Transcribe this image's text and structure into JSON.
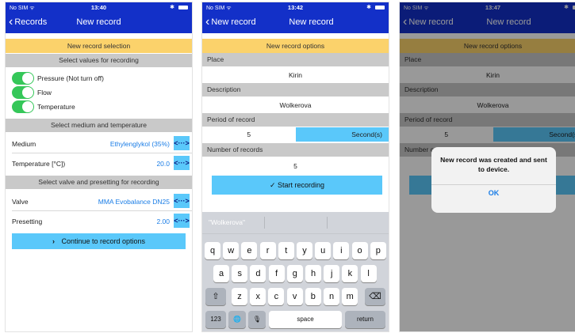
{
  "screen1": {
    "status": {
      "carrier": "No SIM ᯤ",
      "time": "13:40",
      "bt": "✱"
    },
    "nav": {
      "back": "Records",
      "title": "New record"
    },
    "banner": "New record selection",
    "section1": "Select values for recording",
    "toggles": [
      {
        "label": "Pressure (Not turn off)"
      },
      {
        "label": "Flow"
      },
      {
        "label": "Temperature"
      }
    ],
    "section2": "Select medium and temperature",
    "medium": {
      "label": "Medium",
      "value": "Ethylenglykol (35%)"
    },
    "temperature": {
      "label": "Temperature [°C])",
      "value": "20.0"
    },
    "section3": "Select valve and presetting for recording",
    "valve": {
      "label": "Valve",
      "value": "MMA Evobalance DN25"
    },
    "presetting": {
      "label": "Presetting",
      "value": "2.00"
    },
    "continue_button": "Continue to record options",
    "arrow_glyph": "<···>"
  },
  "screen2": {
    "status": {
      "carrier": "No SIM ᯤ",
      "time": "13:42",
      "bt": "✱"
    },
    "nav": {
      "back": "New record",
      "title": "New record"
    },
    "banner": "New record options",
    "place": {
      "label": "Place",
      "value": "Kirin"
    },
    "description": {
      "label": "Description",
      "value": "Wolkerova"
    },
    "period": {
      "label": "Period of record",
      "value": "5",
      "unit": "Second(s)"
    },
    "number": {
      "label": "Number of records",
      "value": "5"
    },
    "start_button": "✓ Start recording",
    "keyboard": {
      "suggestion": "\"Wolkerova\"",
      "row1": [
        "q",
        "w",
        "e",
        "r",
        "t",
        "y",
        "u",
        "i",
        "o",
        "p"
      ],
      "row2": [
        "a",
        "s",
        "d",
        "f",
        "g",
        "h",
        "j",
        "k",
        "l"
      ],
      "row3": [
        "z",
        "x",
        "c",
        "v",
        "b",
        "n",
        "m"
      ],
      "shift": "⇧",
      "backspace": "⌫",
      "numbers": "123",
      "globe": "🌐",
      "mic": "🎙",
      "space": "space",
      "return": "return"
    }
  },
  "screen3": {
    "status": {
      "carrier": "No SIM ᯤ",
      "time": "13:47",
      "bt": "✱"
    },
    "nav": {
      "back": "New record",
      "title": "New record"
    },
    "banner": "New record options",
    "place": {
      "label": "Place",
      "value": "Kirin"
    },
    "description": {
      "label": "Description",
      "value": "Wolkerova"
    },
    "period": {
      "label": "Period of record",
      "value": "5",
      "unit": "Second(s)"
    },
    "number": {
      "label": "Number c"
    },
    "alert": {
      "message": "New record was created and sent to device.",
      "ok": "OK"
    }
  },
  "colors": {
    "nav": "#1330c8",
    "banner": "#fbd26b",
    "section": "#c9c9c9",
    "accent": "#5ac8fa",
    "toggle": "#35c759",
    "link": "#1a7de6"
  }
}
